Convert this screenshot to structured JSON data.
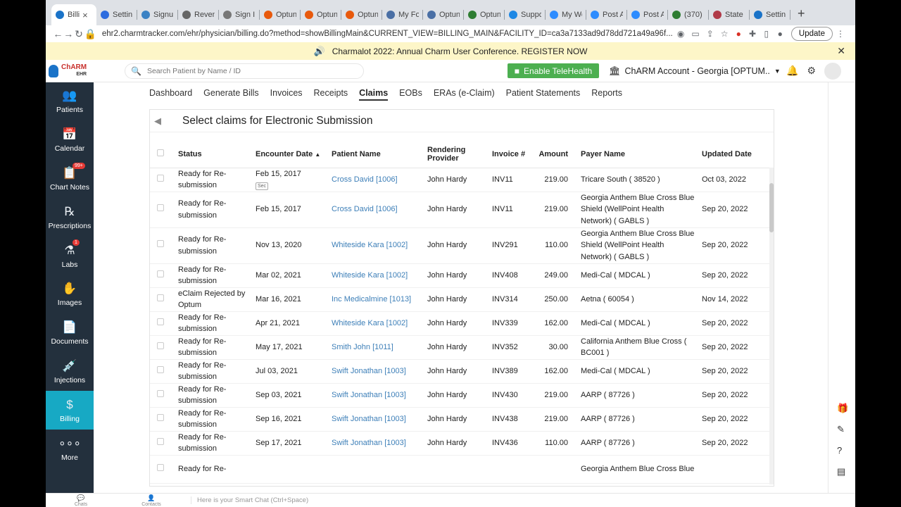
{
  "browser": {
    "tabs": [
      {
        "label": "Billi",
        "color": "#1a73c8",
        "active": true
      },
      {
        "label": "Settin",
        "color": "#2d6cdf"
      },
      {
        "label": "Signu",
        "color": "#3b82c4"
      },
      {
        "label": "Reven",
        "color": "#666666"
      },
      {
        "label": "Sign I",
        "color": "#777777"
      },
      {
        "label": "Optun",
        "color": "#e8590c"
      },
      {
        "label": "Optun",
        "color": "#e8590c"
      },
      {
        "label": "Optun",
        "color": "#e8590c"
      },
      {
        "label": "My Fo",
        "color": "#4a6fa5"
      },
      {
        "label": "Optun",
        "color": "#4a6fa5"
      },
      {
        "label": "Optun",
        "color": "#2e7d32"
      },
      {
        "label": "Suppo",
        "color": "#1e88e5"
      },
      {
        "label": "My We",
        "color": "#2d8cff"
      },
      {
        "label": "Post A",
        "color": "#2d8cff"
      },
      {
        "label": "Post A",
        "color": "#2d8cff"
      },
      {
        "label": "(370)",
        "color": "#2e7d32"
      },
      {
        "label": "State",
        "color": "#b03a48"
      },
      {
        "label": "Settin",
        "color": "#1a73c8"
      }
    ],
    "url": "ehr2.charmtracker.com/ehr/physician/billing.do?method=showBillingMain&CURRENT_VIEW=BILLING_MAIN&FACILITY_ID=ca3a7133ad9d78dd721a49a96f...",
    "update_label": "Update"
  },
  "banner": {
    "text": "Charmalot 2022: Annual Charm User Conference. REGISTER NOW"
  },
  "header": {
    "logo_top": "ChARM",
    "logo_sub": "EHR",
    "search_placeholder": "Search Patient by Name / ID",
    "telehealth_label": "Enable TeleHealth",
    "account": "ChARM Account - Georgia [OPTUM.."
  },
  "sidebar": {
    "items": [
      {
        "label": "Patients",
        "icon": "patients-icon",
        "glyph": "👥"
      },
      {
        "label": "Calendar",
        "icon": "calendar-icon",
        "glyph": "📅"
      },
      {
        "label": "Chart Notes",
        "icon": "chart-notes-icon",
        "glyph": "📋",
        "badge": "99+"
      },
      {
        "label": "Prescriptions",
        "icon": "prescriptions-icon",
        "glyph": "℞"
      },
      {
        "label": "Labs",
        "icon": "labs-icon",
        "glyph": "⚗",
        "badge": "1"
      },
      {
        "label": "Images",
        "icon": "images-icon",
        "glyph": "✋"
      },
      {
        "label": "Documents",
        "icon": "documents-icon",
        "glyph": "📄"
      },
      {
        "label": "Injections",
        "icon": "injections-icon",
        "glyph": "💉"
      },
      {
        "label": "Billing",
        "icon": "billing-icon",
        "glyph": "$",
        "active": true
      },
      {
        "label": "More",
        "icon": "more-icon",
        "glyph": "∘∘∘"
      }
    ]
  },
  "nav": {
    "items": [
      "Dashboard",
      "Generate Bills",
      "Invoices",
      "Receipts",
      "Claims",
      "EOBs",
      "ERAs (e-Claim)",
      "Patient Statements",
      "Reports"
    ],
    "active": "Claims"
  },
  "panel": {
    "title": "Select claims for Electronic Submission",
    "columns": [
      "Status",
      "Encounter Date",
      "Patient Name",
      "Rendering Provider",
      "Invoice #",
      "Amount",
      "Payer Name",
      "Updated Date"
    ],
    "sec_tag": "Sec",
    "rows": [
      {
        "status": "Ready for Re-submission",
        "date": "Feb 15, 2017",
        "sec": true,
        "patient": "Cross David [1006]",
        "provider": "John Hardy",
        "invoice": "INV11",
        "amount": "219.00",
        "payer": "Tricare South ( 38520 )",
        "updated": "Oct 03, 2022"
      },
      {
        "status": "Ready for Re-submission",
        "date": "Feb 15, 2017",
        "patient": "Cross David [1006]",
        "provider": "John Hardy",
        "invoice": "INV11",
        "amount": "219.00",
        "payer": "Georgia Anthem Blue Cross Blue Shield (WellPoint Health Network) ( GABLS )",
        "updated": "Sep 20, 2022"
      },
      {
        "status": "Ready for Re-submission",
        "date": "Nov 13, 2020",
        "patient": "Whiteside Kara [1002]",
        "provider": "John Hardy",
        "invoice": "INV291",
        "amount": "110.00",
        "payer": "Georgia Anthem Blue Cross Blue Shield (WellPoint Health Network) ( GABLS )",
        "updated": "Sep 20, 2022"
      },
      {
        "status": "Ready for Re-submission",
        "date": "Mar 02, 2021",
        "patient": "Whiteside Kara [1002]",
        "provider": "John Hardy",
        "invoice": "INV408",
        "amount": "249.00",
        "payer": "Medi-Cal ( MDCAL )",
        "updated": "Sep 20, 2022"
      },
      {
        "status": "eClaim Rejected by Optum",
        "date": "Mar 16, 2021",
        "patient": "Inc Medicalmine [1013]",
        "provider": "John Hardy",
        "invoice": "INV314",
        "amount": "250.00",
        "payer": "Aetna ( 60054 )",
        "updated": "Nov 14, 2022"
      },
      {
        "status": "Ready for Re-submission",
        "date": "Apr 21, 2021",
        "patient": "Whiteside Kara [1002]",
        "provider": "John Hardy",
        "invoice": "INV339",
        "amount": "162.00",
        "payer": "Medi-Cal ( MDCAL )",
        "updated": "Sep 20, 2022"
      },
      {
        "status": "Ready for Re-submission",
        "date": "May 17, 2021",
        "patient": "Smith John [1011]",
        "provider": "John Hardy",
        "invoice": "INV352",
        "amount": "30.00",
        "payer": "California Anthem Blue Cross ( BC001 )",
        "updated": "Sep 20, 2022"
      },
      {
        "status": "Ready for Re-submission",
        "date": "Jul 03, 2021",
        "patient": "Swift Jonathan [1003]",
        "provider": "John Hardy",
        "invoice": "INV389",
        "amount": "162.00",
        "payer": "Medi-Cal ( MDCAL )",
        "updated": "Sep 20, 2022"
      },
      {
        "status": "Ready for Re-submission",
        "date": "Sep 03, 2021",
        "patient": "Swift Jonathan [1003]",
        "provider": "John Hardy",
        "invoice": "INV430",
        "amount": "219.00",
        "payer": "AARP ( 87726 )",
        "updated": "Sep 20, 2022"
      },
      {
        "status": "Ready for Re-submission",
        "date": "Sep 16, 2021",
        "patient": "Swift Jonathan [1003]",
        "provider": "John Hardy",
        "invoice": "INV438",
        "amount": "219.00",
        "payer": "AARP ( 87726 )",
        "updated": "Sep 20, 2022"
      },
      {
        "status": "Ready for Re-submission",
        "date": "Sep 17, 2021",
        "patient": "Swift Jonathan [1003]",
        "provider": "John Hardy",
        "invoice": "INV436",
        "amount": "110.00",
        "payer": "AARP ( 87726 )",
        "updated": "Sep 20, 2022"
      },
      {
        "status": "Ready for Re-",
        "date": "",
        "patient": "",
        "provider": "",
        "invoice": "",
        "amount": "",
        "payer": "Georgia Anthem Blue Cross Blue",
        "updated": ""
      }
    ]
  },
  "bottom": {
    "chats": "Chats",
    "contacts": "Contacts",
    "smart_chat": "Here is your Smart Chat (Ctrl+Space)"
  }
}
